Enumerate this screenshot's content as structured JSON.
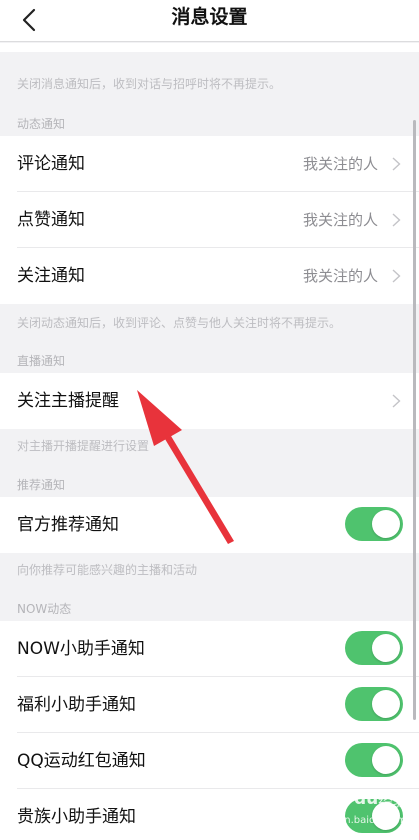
{
  "nav": {
    "title": "消息设置"
  },
  "notes": {
    "message": "关闭消息通知后，收到对话与招呼时将不再提示。",
    "dynamic": "关闭动态通知后，收到评论、点赞与他人关注时将不再提示。",
    "live": "对主播开播提醒进行设置",
    "recommend": "向你推荐可能感兴趣的主播和活动"
  },
  "sections": {
    "dynamic": "动态通知",
    "live": "直播通知",
    "recommend": "推荐通知",
    "now": "NOW动态"
  },
  "rows": {
    "comment": {
      "label": "评论通知",
      "value": "我关注的人"
    },
    "like": {
      "label": "点赞通知",
      "value": "我关注的人"
    },
    "follow": {
      "label": "关注通知",
      "value": "我关注的人"
    },
    "anchor": {
      "label": "关注主播提醒"
    },
    "official": {
      "label": "官方推荐通知",
      "on": true
    },
    "now_helper": {
      "label": "NOW小助手通知",
      "on": true
    },
    "welfare": {
      "label": "福利小助手通知",
      "on": true
    },
    "qq_sport": {
      "label": "QQ运动红包通知",
      "on": true
    },
    "noble": {
      "label": "贵族小助手通知",
      "on": true
    }
  },
  "watermark": {
    "brand": "Bai",
    "brand2": "du",
    "suffix": "经验",
    "url": "jingyan.baidu.com"
  },
  "colors": {
    "toggle_on": "#4fc36e",
    "annotation_arrow": "#e8333b"
  }
}
